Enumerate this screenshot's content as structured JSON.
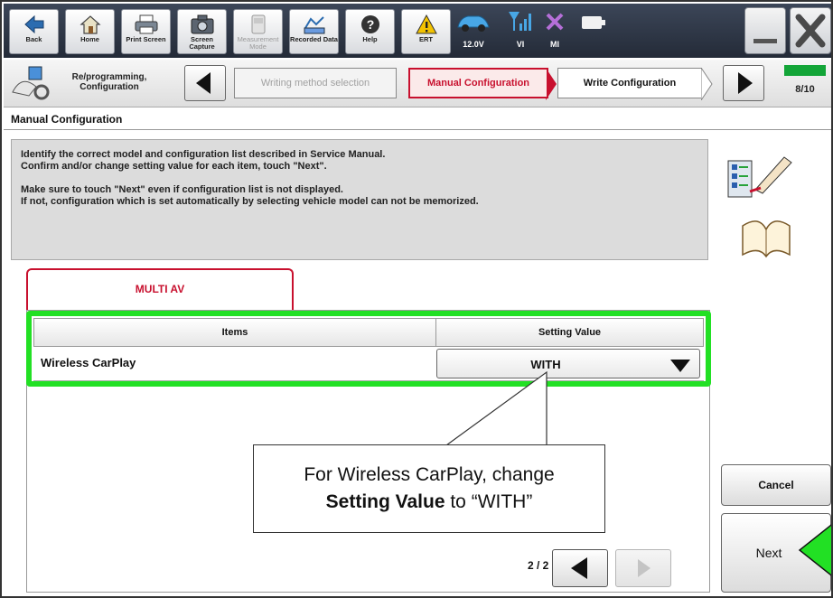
{
  "toolbar": {
    "back": "Back",
    "home": "Home",
    "print_screen": "Print Screen",
    "screen_capture": "Screen Capture",
    "measurement_mode": "Measurement Mode",
    "recorded_data": "Recorded Data",
    "help": "Help",
    "ert": "ERT",
    "voltage": "12.0V",
    "vi": "VI",
    "mi": "MI"
  },
  "stepbar": {
    "section": "Re/programming, Configuration",
    "prev_step": "Writing method selection",
    "current_step": "Manual Configuration",
    "next_step": "Write Configuration",
    "progress": "8/10"
  },
  "page": {
    "title": "Manual Configuration",
    "instructions": [
      "Identify the correct model and configuration list described in Service Manual.",
      "Confirm and/or change setting value for each item, touch \"Next\".",
      "Make sure to touch \"Next\" even if configuration list is not displayed.",
      "If not, configuration which is set automatically by selecting vehicle model can not be memorized."
    ]
  },
  "tab": {
    "label": "MULTI AV"
  },
  "table": {
    "columns": [
      "Items",
      "Setting Value"
    ],
    "rows": [
      {
        "item": "Wireless CarPlay",
        "value": "WITH"
      }
    ]
  },
  "pagination": {
    "label": "2 / 2"
  },
  "buttons": {
    "cancel": "Cancel",
    "next": "Next"
  },
  "callout": {
    "line1": "For Wireless CarPlay, change",
    "bold": "Setting Value",
    "line2_end": " to “WITH”"
  },
  "colors": {
    "accent_red": "#c8102e",
    "highlight_green": "#22e024",
    "progress_green": "#13a538",
    "toolbar_bg": "#2e3646"
  }
}
